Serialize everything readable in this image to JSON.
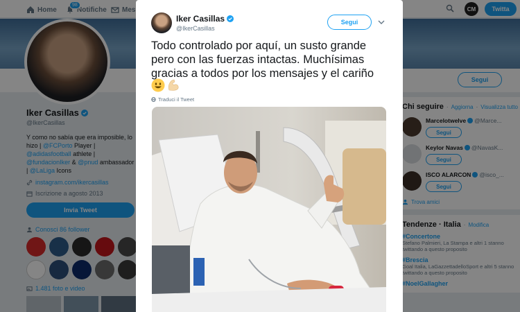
{
  "nav": {
    "home": "Home",
    "notifications": "Notifiche",
    "notifications_count": "98",
    "messages": "Messaggi",
    "tweet_button": "Twitta",
    "avatar_initials": "CM"
  },
  "profile": {
    "name": "Iker Casillas",
    "handle": "@IkerCasillas",
    "bio_1": "Y como no sabía que era imposible, lo hizo | ",
    "bio_fcporto": "@FCPorto",
    "bio_2": " Player | ",
    "bio_adidas": "@adidasfootball",
    "bio_3": " athlete | ",
    "bio_fundacion": "@fundacionIker",
    "bio_4": " & ",
    "bio_pnud": "@pnud",
    "bio_5": " ambassador | ",
    "bio_laliga": "@LaLiga",
    "bio_6": " Icons",
    "website": "instagram.com/ikercasillas",
    "joined": "Iscrizione a agosto 2013",
    "tweet_to_button": "Invia Tweet",
    "followers_known": "Conosci 86 follower",
    "photos_videos": "1.481 foto e video",
    "follow_button": "Segui"
  },
  "who_to_follow": {
    "title": "Chi seguire",
    "refresh": "Aggiorna",
    "view_all": "Visualizza tutto",
    "users": [
      {
        "name": "Marcelotwelve",
        "handle": "@Marce...",
        "button": "Segui"
      },
      {
        "name": "Keylor Navas",
        "handle": "@NavasK...",
        "button": "Segui"
      },
      {
        "name": "ISCO ALARCON",
        "handle": "@isco_...",
        "button": "Segui"
      }
    ],
    "find_friends": "Trova amici"
  },
  "trends": {
    "title": "Tendenze · Italia",
    "change": "Modifica",
    "items": [
      {
        "tag": "#Concertone",
        "desc": "Stefano Palmieri, La Stampa e altri 1 stanno twittando a questo proposito"
      },
      {
        "tag": "#Brescia",
        "desc": "Goal Italia, LaGazzettadelloSport e altri 5 stanno twittando a questo proposito"
      },
      {
        "tag": "#NoelGallagher",
        "desc": ""
      }
    ]
  },
  "tweet": {
    "author_name": "Iker Casillas",
    "author_handle": "@IkerCasillas",
    "follow_button": "Segui",
    "text": "Todo controlado por aquí, un susto grande pero con las fuerzas intactas. Muchísimas gracias a todos por los mensajes y el cariño",
    "emojis": [
      "smiling-face",
      "flexed-biceps"
    ],
    "translate": "Traduci il Tweet"
  },
  "colors": {
    "accent": "#1da1f2",
    "muted": "#657786",
    "background": "#e6ecf0"
  }
}
